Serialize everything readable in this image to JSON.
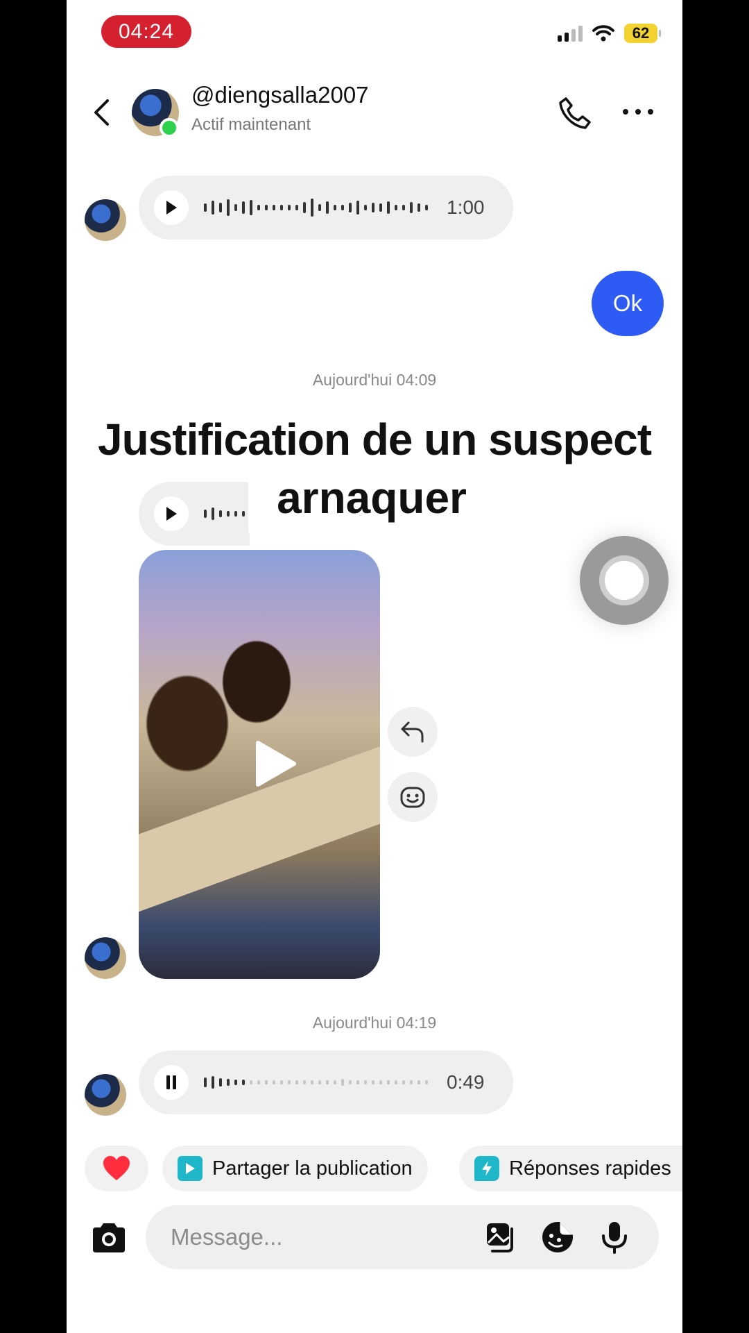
{
  "status_bar": {
    "time": "04:24",
    "battery": "62"
  },
  "header": {
    "username": "@diengsalla2007",
    "presence": "Actif maintenant"
  },
  "messages": {
    "voice1_duration": "1:00",
    "outgoing_text": "Ok",
    "timestamp1": "Aujourd'hui 04:09",
    "timestamp2": "Aujourd'hui 04:19",
    "voice2_duration": "0:49"
  },
  "caption": {
    "line1": "Justification de un suspect",
    "line2": "arnaquer"
  },
  "quick_actions": {
    "share_label": "Partager la publication",
    "quick_replies_label": "Réponses rapides"
  },
  "composer": {
    "placeholder": "Message..."
  },
  "colors": {
    "accent_blue": "#2f5bf5",
    "online_green": "#2fd04b",
    "time_pill_red": "#d4202f",
    "battery_yellow": "#f2d230"
  },
  "icons": [
    "back-icon",
    "phone-icon",
    "more-icon",
    "play-icon",
    "pause-icon",
    "reply-icon",
    "emoji-react-icon",
    "heart-icon",
    "share-post-icon",
    "quick-reply-icon",
    "camera-icon",
    "gallery-icon",
    "sticker-icon",
    "mic-icon"
  ]
}
